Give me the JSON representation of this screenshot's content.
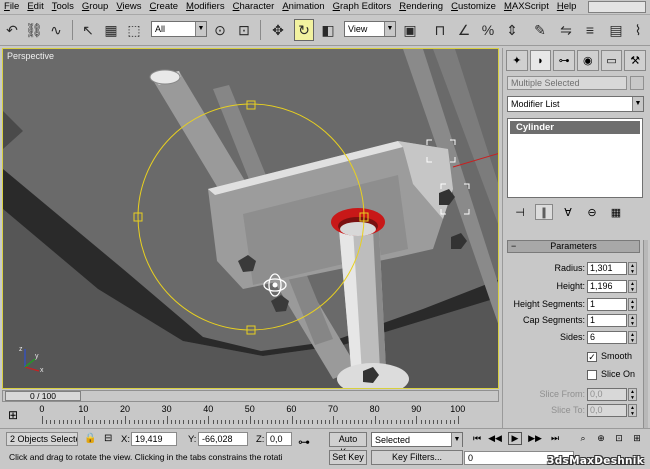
{
  "menu": {
    "items": [
      {
        "u": "F",
        "rest": "ile"
      },
      {
        "u": "E",
        "rest": "dit"
      },
      {
        "u": "T",
        "rest": "ools"
      },
      {
        "u": "G",
        "rest": "roup"
      },
      {
        "u": "V",
        "rest": "iews"
      },
      {
        "u": "C",
        "rest": "reate"
      },
      {
        "u": "M",
        "rest": "odifiers"
      },
      {
        "u": "C",
        "rest": "haracter"
      },
      {
        "u": "A",
        "rest": "nimation"
      },
      {
        "u": "G",
        "rest": "raph Editors"
      },
      {
        "u": "R",
        "rest": "endering"
      },
      {
        "u": "C",
        "rest": "ustomize"
      },
      {
        "u": "M",
        "rest": "AXScript"
      },
      {
        "u": "H",
        "rest": "elp"
      }
    ]
  },
  "toolbar": {
    "selection_filter": "All",
    "ref_coord": "View"
  },
  "viewport": {
    "label": "Perspective",
    "axis_x": "x",
    "axis_y": "y",
    "axis_z": "z"
  },
  "command_panel": {
    "selection_name": "Multiple Selected",
    "modifier_list": "Modifier List",
    "stack_item": "Cylinder",
    "rollout_title": "Parameters",
    "params": [
      {
        "label": "Radius:",
        "value": "1,301",
        "enabled": true
      },
      {
        "label": "Height:",
        "value": "1,196",
        "enabled": true
      },
      {
        "label": "Height Segments:",
        "value": "1",
        "enabled": true
      },
      {
        "label": "Cap Segments:",
        "value": "1",
        "enabled": true
      },
      {
        "label": "Sides:",
        "value": "6",
        "enabled": true
      }
    ],
    "smooth_label": "Smooth",
    "smooth_checked": "✓",
    "slice_on_label": "Slice On",
    "slice_from_label": "Slice From:",
    "slice_from_value": "0,0",
    "slice_to_label": "Slice To:",
    "slice_to_value": "0,0"
  },
  "timeline": {
    "frame_readout": "0 / 100",
    "ticks": [
      "0",
      "10",
      "20",
      "30",
      "40",
      "50",
      "60",
      "70",
      "80",
      "90",
      "100"
    ]
  },
  "status": {
    "selection": "2 Objects Selecte",
    "x_label": "X:",
    "x_value": "19,419",
    "y_label": "Y:",
    "y_value": "-66,028",
    "z_label": "Z:",
    "z_value": "0,0",
    "auto_key": "Auto Key",
    "key_mode": "Selected",
    "set_key": "Set Key",
    "key_filters": "Key Filters...",
    "prompt": "Click and drag to rotate the view.  Clicking in the tabs constrains the rotati",
    "current_frame": "0",
    "watermark": "3dsMaxDeshnik"
  },
  "colors": {
    "viewport_border": "#d8d040",
    "gizmo": "#e8d020",
    "stack_highlight": "#6e6e6e",
    "red_ring": "#c81818"
  }
}
